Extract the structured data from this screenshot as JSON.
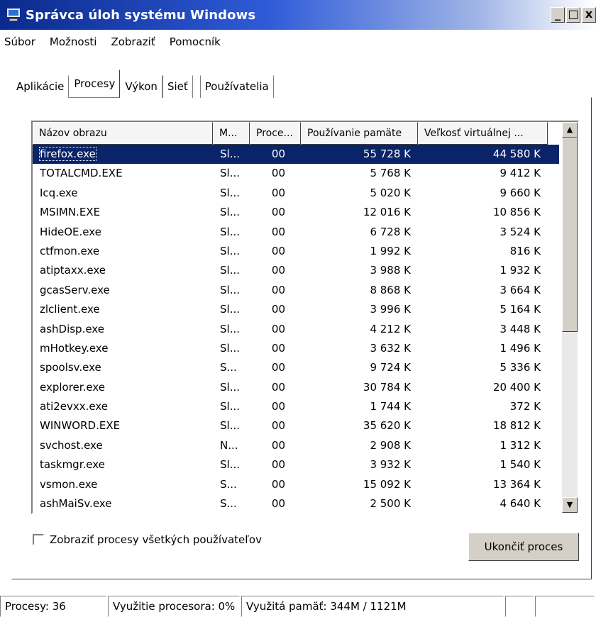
{
  "window": {
    "title": "Správca úloh systému Windows",
    "buttons": {
      "minimize": "_",
      "maximize": "□",
      "close": "x"
    }
  },
  "menu": [
    "Súbor",
    "Možnosti",
    "Zobraziť",
    "Pomocník"
  ],
  "tabs": [
    "Aplikácie",
    "Procesy",
    "Výkon",
    "Sieť",
    "Používatelia"
  ],
  "active_tab": "Procesy",
  "table": {
    "headers": [
      "Názov obrazu",
      "M...",
      "Proce...",
      "Používanie pamäte",
      "Veľkosť virtuálnej ..."
    ],
    "rows": [
      [
        "firefox.exe",
        "Sl...",
        "00",
        "55 728 K",
        "44 580 K"
      ],
      [
        "TOTALCMD.EXE",
        "Sl...",
        "00",
        "5 768 K",
        "9 412 K"
      ],
      [
        "Icq.exe",
        "Sl...",
        "00",
        "5 020 K",
        "9 660 K"
      ],
      [
        "MSIMN.EXE",
        "Sl...",
        "00",
        "12 016 K",
        "10 856 K"
      ],
      [
        "HideOE.exe",
        "Sl...",
        "00",
        "6 728 K",
        "3 524 K"
      ],
      [
        "ctfmon.exe",
        "Sl...",
        "00",
        "1 992 K",
        "816 K"
      ],
      [
        "atiptaxx.exe",
        "Sl...",
        "00",
        "3 988 K",
        "1 932 K"
      ],
      [
        "gcasServ.exe",
        "Sl...",
        "00",
        "8 868 K",
        "3 664 K"
      ],
      [
        "zlclient.exe",
        "Sl...",
        "00",
        "3 996 K",
        "5 164 K"
      ],
      [
        "ashDisp.exe",
        "Sl...",
        "00",
        "4 212 K",
        "3 448 K"
      ],
      [
        "mHotkey.exe",
        "Sl...",
        "00",
        "3 632 K",
        "1 496 K"
      ],
      [
        "spoolsv.exe",
        "S...",
        "00",
        "9 724 K",
        "5 336 K"
      ],
      [
        "explorer.exe",
        "Sl...",
        "00",
        "30 784 K",
        "20 400 K"
      ],
      [
        "ati2evxx.exe",
        "Sl...",
        "00",
        "1 744 K",
        "372 K"
      ],
      [
        "WINWORD.EXE",
        "Sl...",
        "00",
        "35 620 K",
        "18 812 K"
      ],
      [
        "svchost.exe",
        "N...",
        "00",
        "2 908 K",
        "1 312 K"
      ],
      [
        "taskmgr.exe",
        "Sl...",
        "00",
        "3 932 K",
        "1 540 K"
      ],
      [
        "vsmon.exe",
        "S...",
        "00",
        "15 092 K",
        "13 364 K"
      ],
      [
        "ashMaiSv.exe",
        "S...",
        "00",
        "2 500 K",
        "4 640 K"
      ]
    ],
    "selected_row": 0
  },
  "show_all_label": "Zobraziť procesy všetkých používateľov",
  "end_process_label": "Ukončiť proces",
  "status": {
    "processes": "Procesy: 36",
    "cpu": "Využitie procesora: 0%",
    "memory": "Využitá pamäť: 344M / 1121M"
  },
  "colors": {
    "selection": "#0a246a",
    "titlebar": "#0a2a8c"
  },
  "icons": {
    "app": "task-manager-icon",
    "scroll_up": "arrow-up-icon",
    "scroll_down": "arrow-down-icon"
  }
}
